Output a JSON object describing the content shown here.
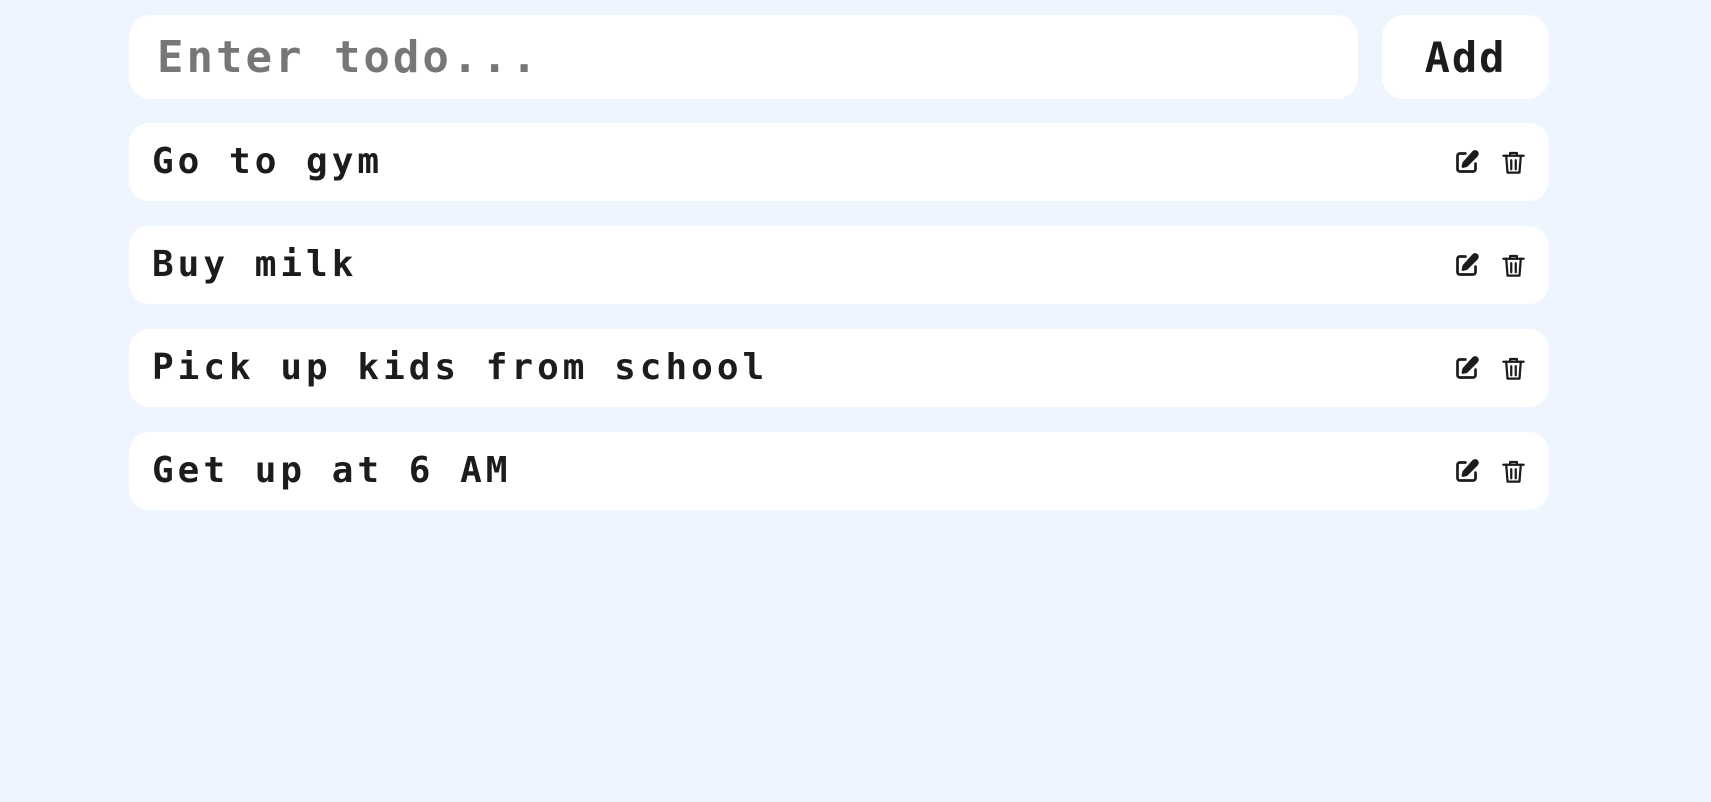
{
  "input": {
    "placeholder": "Enter todo...",
    "value": ""
  },
  "add_button": {
    "label": "Add"
  },
  "todos": [
    {
      "text": "Go to gym",
      "edit_icon": "edit-icon",
      "delete_icon": "trash-icon"
    },
    {
      "text": "Buy milk",
      "edit_icon": "edit-icon",
      "delete_icon": "trash-icon"
    },
    {
      "text": "Pick up kids from school",
      "edit_icon": "edit-icon",
      "delete_icon": "trash-icon"
    },
    {
      "text": "Get up at 6 AM",
      "edit_icon": "edit-icon",
      "delete_icon": "trash-icon"
    }
  ],
  "colors": {
    "background": "#eef5fe",
    "card": "#ffffff",
    "text": "#1c1c1e",
    "placeholder": "#777777"
  }
}
